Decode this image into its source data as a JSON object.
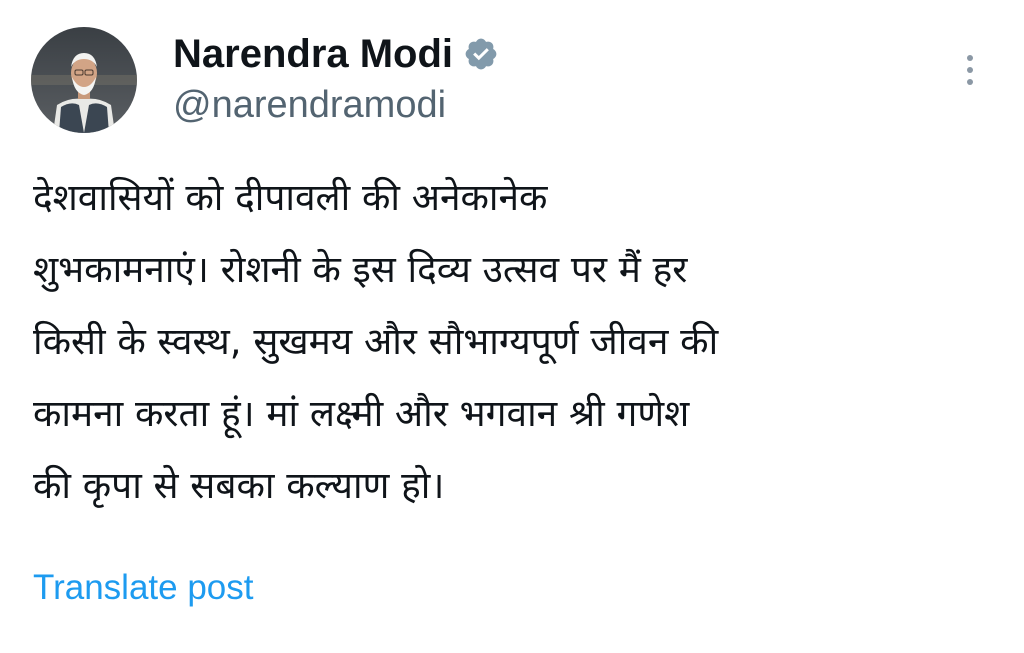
{
  "author": {
    "display_name": "Narendra Modi",
    "handle": "@narendramodi",
    "verified": true,
    "verified_color": "#829aab"
  },
  "post": {
    "lines": [
      "देशवासियों को दीपावली की अनेकानेक",
      "शुभकामनाएं। रोशनी के इस दिव्य उत्सव पर मैं हर",
      "किसी के स्वस्थ, सुखमय और सौभाग्यपूर्ण जीवन की",
      "कामना करता हूं। मां लक्ष्मी और भगवान श्री गणेश",
      "की कृपा से सबका कल्याण हो।"
    ]
  },
  "actions": {
    "translate_label": "Translate post",
    "more_icon": "more-vertical-icon"
  },
  "colors": {
    "text": "#0f1419",
    "secondary": "#536471",
    "link": "#1d9bf0"
  }
}
